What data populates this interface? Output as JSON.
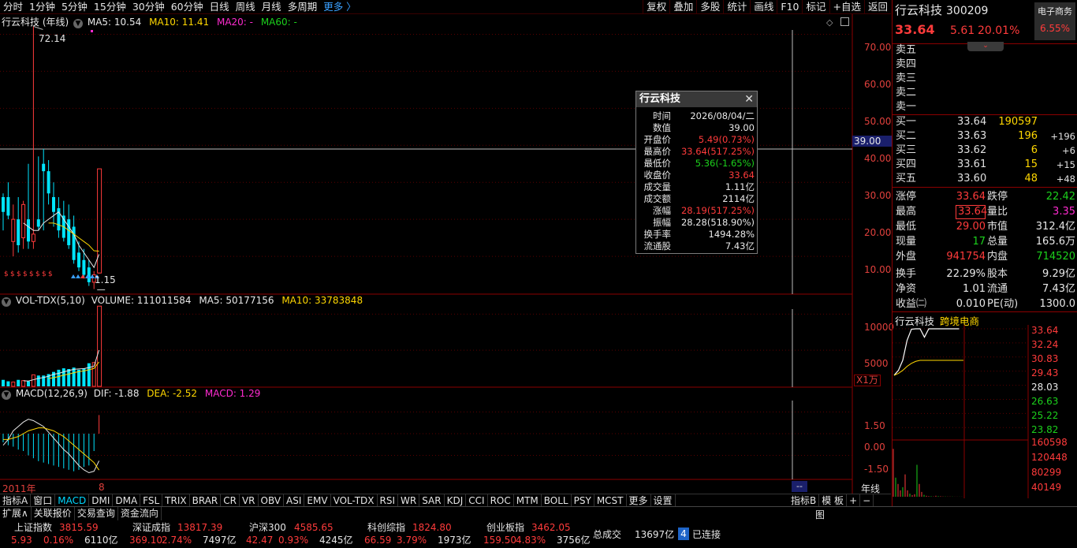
{
  "topbar": {
    "left": [
      "分时",
      "1分钟",
      "5分钟",
      "15分钟",
      "30分钟",
      "60分钟",
      "日线",
      "周线",
      "月线",
      "多周期"
    ],
    "more": "更多 〉",
    "right": [
      "复权",
      "叠加",
      "多股",
      "统计",
      "画线",
      "F10",
      "标记",
      "+自选",
      "返回"
    ]
  },
  "ma_line": {
    "title": "行云科技 (年线)",
    "ma5": "MA5: 10.54",
    "ma10": "MA10: 11.41",
    "ma20": "MA20: -",
    "ma60": "MA60: -"
  },
  "vol_line": {
    "title": "VOL-TDX(5,10)",
    "volume": "VOLUME: 111011584",
    "ma5": "MA5: 50177156",
    "ma10": "MA10: 33783848",
    "unit": "X1万"
  },
  "macd_line": {
    "title": "MACD(12,26,9)",
    "dif": "DIF: -1.88",
    "dea": "DEA: -2.52",
    "macd": "MACD: 1.29"
  },
  "price_axis": [
    "70.00",
    "60.00",
    "50.00",
    "40.00",
    "30.00",
    "20.00",
    "10.00"
  ],
  "crosshair_price": "39.00",
  "vol_axis": [
    "10000",
    "5000"
  ],
  "macd_axis": [
    "1.50",
    "0.00",
    "-1.50"
  ],
  "x_axis": {
    "start": "2011年",
    "mid": "8",
    "period": "年线",
    "marker": "--"
  },
  "labels": {
    "high": "72.14",
    "low": "1.15"
  },
  "tooltip": {
    "title": "行云科技",
    "rows": [
      {
        "k": "时间",
        "v": "2026/08/04/二",
        "c": "white"
      },
      {
        "k": "数值",
        "v": "39.00",
        "c": "white"
      },
      {
        "k": "开盘价",
        "v": "5.49(0.73%)",
        "c": "red"
      },
      {
        "k": "最高价",
        "v": "33.64(517.25%)",
        "c": "red"
      },
      {
        "k": "最低价",
        "v": "5.36(-1.65%)",
        "c": "green"
      },
      {
        "k": "收盘价",
        "v": "33.64",
        "c": "red"
      },
      {
        "k": "成交量",
        "v": "1.11亿",
        "c": "white"
      },
      {
        "k": "成交额",
        "v": "2114亿",
        "c": "white"
      },
      {
        "k": "涨幅",
        "v": "28.19(517.25%)",
        "c": "red"
      },
      {
        "k": "振幅",
        "v": "28.28(518.90%)",
        "c": "white"
      },
      {
        "k": "换手率",
        "v": "1494.28%",
        "c": "white"
      },
      {
        "k": "流通股",
        "v": "7.43亿",
        "c": "white"
      }
    ]
  },
  "quote": {
    "name": "行云科技",
    "code": "300209",
    "sector_btn": "电子商务",
    "sector_pct": "6.55%",
    "price": "33.64",
    "change": "5.61",
    "pct": "20.01%",
    "sells": [
      "卖五",
      "卖四",
      "卖三",
      "卖二",
      "卖一"
    ],
    "buys": [
      {
        "k": "买一",
        "p": "33.64",
        "v": "190597",
        "d": ""
      },
      {
        "k": "买二",
        "p": "33.63",
        "v": "196",
        "d": "+196"
      },
      {
        "k": "买三",
        "p": "33.62",
        "v": "6",
        "d": "+6"
      },
      {
        "k": "买四",
        "p": "33.61",
        "v": "15",
        "d": "+15"
      },
      {
        "k": "买五",
        "p": "33.60",
        "v": "48",
        "d": "+48"
      }
    ],
    "stats": [
      {
        "k1": "涨停",
        "v1": "33.64",
        "c1": "red",
        "k2": "跌停",
        "v2": "22.42",
        "c2": "green"
      },
      {
        "k1": "最高",
        "v1": "33.64",
        "c1": "red",
        "k2": "量比",
        "v2": "3.35",
        "c2": "mag"
      },
      {
        "k1": "最低",
        "v1": "29.00",
        "c1": "red",
        "k2": "市值",
        "v2": "312.4亿",
        "c2": "white"
      },
      {
        "k1": "现量",
        "v1": "17",
        "c1": "green",
        "k2": "总量",
        "v2": "165.6万",
        "c2": "white"
      },
      {
        "k1": "外盘",
        "v1": "941754",
        "c1": "red",
        "k2": "内盘",
        "v2": "714520",
        "c2": "green"
      },
      {
        "k1": "换手",
        "v1": "22.29%",
        "c1": "white",
        "k2": "股本",
        "v2": "9.29亿",
        "c2": "white"
      },
      {
        "k1": "净资",
        "v1": "1.01",
        "c1": "white",
        "k2": "流通",
        "v2": "7.43亿",
        "c2": "white"
      },
      {
        "k1": "收益㈡",
        "v1": "0.010",
        "c1": "white",
        "k2": "PE(动)",
        "v2": "1300.0",
        "c2": "white"
      }
    ],
    "mini_title": "行云科技",
    "mini_sector": "跨境电商",
    "mini_price_axis": [
      {
        "v": "33.64",
        "c": "red"
      },
      {
        "v": "32.24",
        "c": "red"
      },
      {
        "v": "30.83",
        "c": "red"
      },
      {
        "v": "29.43",
        "c": "red"
      },
      {
        "v": "28.03",
        "c": "white"
      },
      {
        "v": "26.63",
        "c": "green"
      },
      {
        "v": "25.22",
        "c": "green"
      },
      {
        "v": "23.82",
        "c": "green"
      }
    ],
    "mini_vol_axis": [
      "160598",
      "120448",
      "80299",
      "40149"
    ]
  },
  "bottom_tabs": [
    "指标A",
    "窗口",
    "MACD",
    "DMI",
    "DMA",
    "FSL",
    "TRIX",
    "BRAR",
    "CR",
    "VR",
    "OBV",
    "ASI",
    "EMV",
    "VOL-TDX",
    "RSI",
    "WR",
    "SAR",
    "KDJ",
    "CCI",
    "ROC",
    "MTM",
    "BOLL",
    "PSY",
    "MCST",
    "更多",
    "设置"
  ],
  "bottom_right_tabs": [
    "指标B",
    "模 板",
    "+",
    "−"
  ],
  "status": {
    "row1_left": [
      "扩展∧",
      "关联报价",
      "交易查询",
      "资金流向"
    ],
    "indices": [
      {
        "name": "上证指数",
        "val": "3815.59",
        "chg": "5.93",
        "pct": "0.16%",
        "amt": "6110亿"
      },
      {
        "name": "深证成指",
        "val": "13817.39",
        "chg": "369.10",
        "pct": "2.74%",
        "amt": "7497亿"
      },
      {
        "name": "沪深300",
        "val": "4585.65",
        "chg": "42.47",
        "pct": "0.93%",
        "amt": "4245亿"
      },
      {
        "name": "科创综指",
        "val": "1824.80",
        "chg": "66.59",
        "pct": "3.79%",
        "amt": "1973亿"
      },
      {
        "name": "创业板指",
        "val": "3462.05",
        "chg": "159.50",
        "pct": "4.83%",
        "amt": "3756亿"
      }
    ],
    "total_label": "总成交",
    "total_val": "13697亿",
    "conn_num": "4",
    "conn_text": "已连接",
    "tu": "图"
  },
  "chart_data": {
    "type": "candlestick",
    "period": "yearly",
    "x_start": "2011年",
    "price_ylim": [
      0,
      75
    ],
    "vol_ylim": [
      0,
      12000
    ],
    "vol_unit": "X1万",
    "macd_ylim": [
      -3,
      3
    ],
    "candles": [
      {
        "o": 22,
        "h": 27,
        "l": 17,
        "c": 26,
        "up": false
      },
      {
        "o": 26,
        "h": 30,
        "l": 20,
        "c": 21,
        "up": false
      },
      {
        "o": 14,
        "h": 24,
        "l": 10,
        "c": 20,
        "up": true
      },
      {
        "o": 20,
        "h": 26,
        "l": 11,
        "c": 13,
        "up": false
      },
      {
        "o": 15,
        "h": 25,
        "l": 12,
        "c": 24,
        "up": true
      },
      {
        "o": 20,
        "h": 35,
        "l": 12,
        "c": 14,
        "up": false
      },
      {
        "o": 14,
        "h": 72.14,
        "l": 12,
        "c": 16,
        "up": true
      },
      {
        "o": 20,
        "h": 37,
        "l": 17,
        "c": 18,
        "up": false
      },
      {
        "o": 35,
        "h": 39,
        "l": 17,
        "c": 33,
        "up": false
      },
      {
        "o": 33,
        "h": 36,
        "l": 24,
        "c": 27,
        "up": false
      },
      {
        "o": 26,
        "h": 30,
        "l": 18,
        "c": 22,
        "up": false
      },
      {
        "o": 23,
        "h": 26,
        "l": 15,
        "c": 17,
        "up": false
      },
      {
        "o": 21,
        "h": 25,
        "l": 14,
        "c": 15,
        "up": false
      },
      {
        "o": 20,
        "h": 24,
        "l": 12,
        "c": 13,
        "up": false
      },
      {
        "o": 18,
        "h": 21,
        "l": 8,
        "c": 9,
        "up": false
      },
      {
        "o": 11,
        "h": 14,
        "l": 6,
        "c": 7,
        "up": false
      },
      {
        "o": 9,
        "h": 12,
        "l": 4,
        "c": 5,
        "up": false
      },
      {
        "o": 7,
        "h": 9,
        "l": 2,
        "c": 3,
        "up": false
      },
      {
        "o": 3,
        "h": 6,
        "l": 1.15,
        "c": 5,
        "up": true
      },
      {
        "o": 5.49,
        "h": 33.64,
        "l": 5.36,
        "c": 33.64,
        "up": true
      }
    ],
    "ma5": [
      null,
      null,
      null,
      null,
      19,
      18,
      17,
      17,
      19,
      20,
      21,
      22,
      20,
      18,
      16,
      13,
      11,
      9,
      7,
      10.54
    ],
    "ma10": [
      null,
      null,
      null,
      null,
      null,
      null,
      null,
      null,
      null,
      19,
      19,
      18.5,
      18,
      17,
      16,
      15,
      14,
      13,
      11.5,
      11.41
    ],
    "volume": [
      900,
      700,
      600,
      900,
      800,
      700,
      1600,
      1500,
      1500,
      1700,
      2000,
      2300,
      2500,
      2400,
      2600,
      2300,
      2500,
      3200,
      3300,
      11101
    ],
    "vol_up": [
      false,
      false,
      true,
      false,
      true,
      false,
      true,
      false,
      false,
      false,
      false,
      false,
      false,
      false,
      false,
      false,
      false,
      false,
      true,
      true
    ],
    "vol_ma5": [
      null,
      null,
      null,
      null,
      780,
      740,
      920,
      1100,
      1220,
      1400,
      1660,
      1800,
      2000,
      2180,
      2360,
      2420,
      2460,
      2600,
      2780,
      5018
    ],
    "vol_ma10": [
      null,
      null,
      null,
      null,
      null,
      null,
      null,
      null,
      null,
      1090,
      1200,
      1360,
      1550,
      1700,
      1880,
      2040,
      2130,
      2300,
      2480,
      3378
    ],
    "dif": [
      -0.8,
      -0.4,
      0.2,
      0.5,
      0.8,
      1.0,
      0.9,
      0.7,
      0.5,
      0.1,
      -0.3,
      -0.7,
      -1.1,
      -1.4,
      -1.8,
      -2.2,
      -2.5,
      -2.7,
      -2.6,
      -1.88
    ],
    "dea": [
      -0.4,
      -0.4,
      -0.3,
      -0.2,
      0.0,
      0.2,
      0.3,
      0.4,
      0.4,
      0.3,
      0.2,
      0.0,
      -0.2,
      -0.5,
      -0.8,
      -1.1,
      -1.4,
      -1.7,
      -2.0,
      -2.52
    ],
    "macd": [
      -0.6,
      -0.8,
      -0.9,
      -1.1,
      -1.2,
      -1.5,
      -1.7,
      -1.9,
      -2.0,
      -2.1,
      -2.2,
      -2.3,
      -2.4,
      -2.5,
      -2.6,
      -2.5,
      -2.3,
      -2.2,
      -1.2,
      1.29
    ],
    "intraday": {
      "price_ylim": [
        23.82,
        33.64
      ],
      "avg": 30.3,
      "price": [
        29.0,
        29.5,
        30.5,
        32.5,
        33.6,
        33.64,
        33.64,
        32.8,
        33.64,
        33.64,
        33.64,
        33.64,
        33.64,
        33.64,
        33.64,
        33.64
      ],
      "avgline": [
        29.0,
        29.2,
        29.5,
        29.9,
        30.2,
        30.4,
        30.5,
        30.5,
        30.5,
        30.5,
        30.5,
        30.5,
        30.5,
        30.5,
        30.5,
        30.5
      ],
      "vol_ylim": [
        0,
        160598
      ],
      "vol": [
        150000,
        60000,
        40000,
        20000,
        30000,
        70000,
        20000,
        10000,
        5000,
        8000,
        100000,
        40000,
        15000,
        6000,
        3000,
        2000,
        1500,
        1000,
        3000,
        2000,
        1500,
        1000,
        800,
        600,
        500,
        500,
        400,
        400,
        300,
        300
      ]
    }
  }
}
